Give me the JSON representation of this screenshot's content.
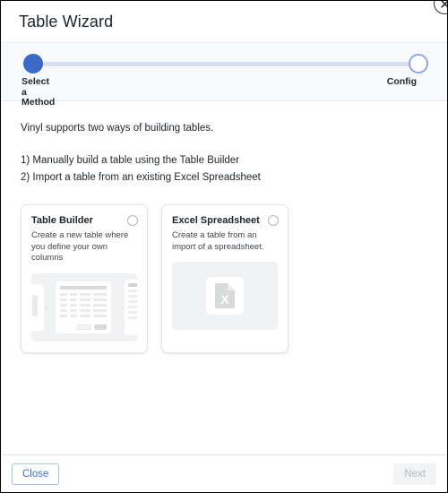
{
  "dialog": {
    "title": "Table Wizard",
    "close_icon": "close-icon"
  },
  "stepper": {
    "steps": [
      {
        "label": "Select a\nMethod",
        "state": "active",
        "dot": "filled-dot"
      },
      {
        "label": "Config",
        "state": "upcoming",
        "dot": "hollow-dot"
      }
    ],
    "track_color": "#d7e0f3",
    "active_color": "#3a69c7"
  },
  "content": {
    "intro": "Vinyl supports two ways of building tables.",
    "bullets": [
      "1) Manually build a table using the Table Builder",
      "2) Import a table from an existing Excel Spreadsheet"
    ]
  },
  "cards": [
    {
      "title": "Table Builder",
      "description": "Create a new table where you define your own columns",
      "radio_selected": false,
      "preview_type": "table-builder-wireframe",
      "chevron_left": "‹",
      "chevron_right": "›"
    },
    {
      "title": "Excel Spreadsheet",
      "description": "Create a table from an import of a spreadsheet.",
      "radio_selected": false,
      "preview_type": "excel-file-icon",
      "icon_letter": "X"
    }
  ],
  "footer": {
    "close_label": "Close",
    "next_label": "Next",
    "next_disabled": true
  }
}
